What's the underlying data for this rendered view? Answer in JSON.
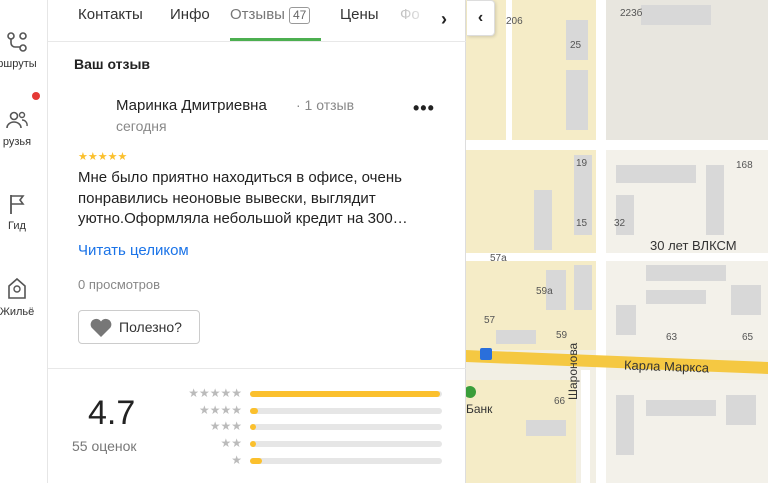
{
  "rail": {
    "routes_label": "ршруты",
    "friends_label": "рузья",
    "guide_label": "Гид",
    "housing_label": "Жильё"
  },
  "tabs": {
    "contacts": "Контакты",
    "info": "Инфо",
    "reviews": "Отзывы",
    "reviews_count": "47",
    "prices": "Цены",
    "photos": "Фо"
  },
  "review": {
    "section_title": "Ваш отзыв",
    "author": "Маринка Дмитриевна",
    "author_meta": "· 1 отзыв",
    "date": "сегодня",
    "stars": "★★★★★",
    "text": "Мне было приятно находиться в офисе, очень понравились неоновые вывески, выглядит уютно.Оформляла небольшой кредит на 300…",
    "read_more": "Читать целиком",
    "views": "0 просмотров",
    "useful_label": "Полезно?"
  },
  "rating": {
    "value": "4.7",
    "count_label": "55 оценок",
    "distribution": [
      {
        "stars": "★★★★★",
        "fraction": 0.99
      },
      {
        "stars": "★★★★",
        "fraction": 0.04
      },
      {
        "stars": "★★★",
        "fraction": 0.02
      },
      {
        "stars": "★★",
        "fraction": 0.01
      },
      {
        "stars": "★",
        "fraction": 0.06
      }
    ]
  },
  "map": {
    "labels": {
      "n206": "206",
      "n223b": "223б",
      "n25": "25",
      "n19": "19",
      "n168": "168",
      "n15": "15",
      "n32": "32",
      "n57a": "57а",
      "n59a": "59а",
      "n57": "57",
      "n59": "59",
      "n63": "63",
      "n65": "65",
      "n66": "66"
    },
    "streets": {
      "vlksm": "30 лет ВЛКСМ",
      "marx": "Карла Маркса",
      "sharonova": "Шаронова",
      "bank": "Банк"
    },
    "colors": {
      "background": "#f2efe4",
      "residential": "#f5ecc7",
      "building": "#d8d8d8",
      "major_road": "#f5c842",
      "bus_stop": "#2a6fdb",
      "bank": "#3a9e3a"
    }
  },
  "colors": {
    "accent_green": "#4caf50",
    "link_blue": "#1a73e8",
    "star_yellow": "#fbc02d",
    "notification_red": "#e53935"
  }
}
